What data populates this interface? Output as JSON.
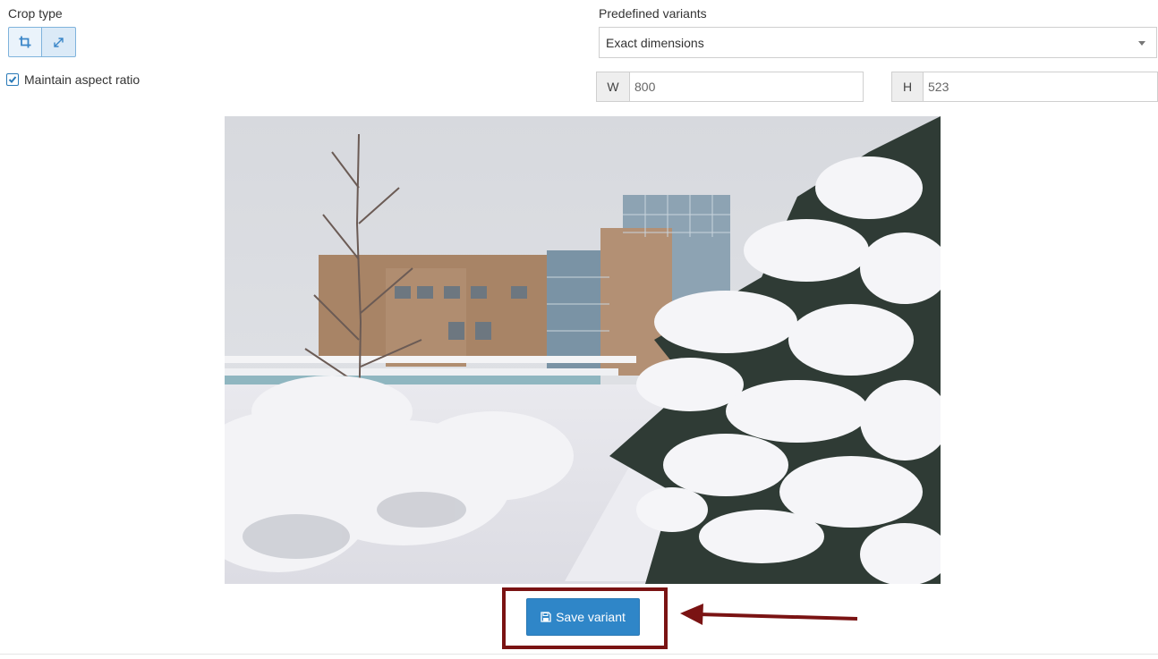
{
  "crop_type": {
    "label": "Crop type",
    "buttons": [
      {
        "icon": "crop-icon"
      },
      {
        "icon": "resize-expand-icon"
      }
    ]
  },
  "aspect": {
    "label": "Maintain aspect ratio",
    "checked": true
  },
  "variants": {
    "label": "Predefined variants",
    "selected": "Exact dimensions"
  },
  "dimensions": {
    "width_label": "W",
    "width_value": "800",
    "height_label": "H",
    "height_value": "523"
  },
  "preview": {
    "alt": "Snowy campus with snow-covered trees and buildings"
  },
  "save": {
    "label": "Save variant",
    "icon": "save-icon"
  },
  "colors": {
    "primary": "#2f86c8",
    "highlight": "#7a1313"
  }
}
